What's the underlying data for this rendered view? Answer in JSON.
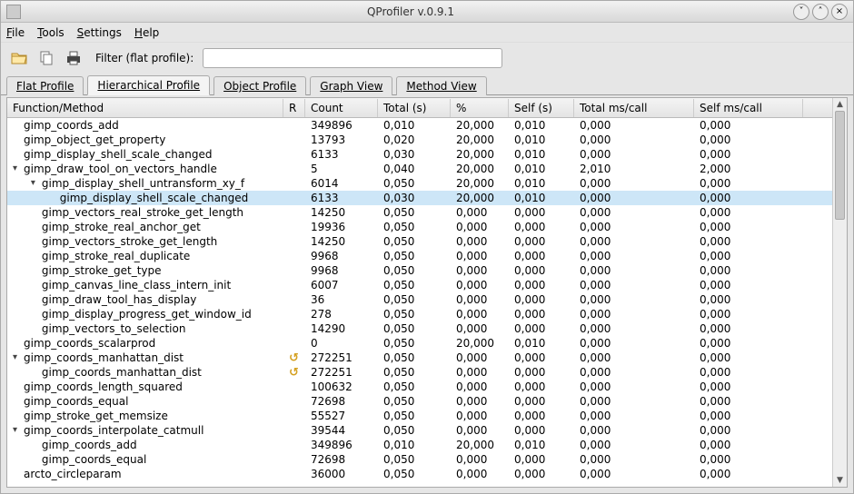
{
  "window": {
    "title": "QProfiler v.0.9.1"
  },
  "menu": {
    "file": "File",
    "tools": "Tools",
    "settings": "Settings",
    "help": "Help"
  },
  "toolbar": {
    "filter_label": "Filter (flat profile):",
    "filter_value": ""
  },
  "tabs": {
    "flat": "Flat Profile",
    "hierarchical": "Hierarchical Profile",
    "object": "Object Profile",
    "graph": "Graph View",
    "method": "Method View"
  },
  "columns": {
    "fn": "Function/Method",
    "r": "R",
    "count": "Count",
    "total": "Total (s)",
    "pct": "%",
    "self": "Self (s)",
    "total_ms": "Total ms/call",
    "self_ms": "Self ms/call"
  },
  "rows": [
    {
      "indent": 1,
      "exp": "",
      "r": "",
      "fn": "gimp_coords_add",
      "count": "349896",
      "total": "0,010",
      "pct": "20,000",
      "self": "0,010",
      "tms": "0,000",
      "sms": "0,000"
    },
    {
      "indent": 1,
      "exp": "",
      "r": "",
      "fn": "gimp_object_get_property",
      "count": "13793",
      "total": "0,020",
      "pct": "20,000",
      "self": "0,010",
      "tms": "0,000",
      "sms": "0,000"
    },
    {
      "indent": 1,
      "exp": "",
      "r": "",
      "fn": "gimp_display_shell_scale_changed",
      "count": "6133",
      "total": "0,030",
      "pct": "20,000",
      "self": "0,010",
      "tms": "0,000",
      "sms": "0,000"
    },
    {
      "indent": 1,
      "exp": "v",
      "r": "",
      "fn": "gimp_draw_tool_on_vectors_handle",
      "count": "5",
      "total": "0,040",
      "pct": "20,000",
      "self": "0,010",
      "tms": "2,010",
      "sms": "2,000"
    },
    {
      "indent": 2,
      "exp": "v",
      "r": "",
      "fn": "gimp_display_shell_untransform_xy_f",
      "count": "6014",
      "total": "0,050",
      "pct": "20,000",
      "self": "0,010",
      "tms": "0,000",
      "sms": "0,000"
    },
    {
      "indent": 3,
      "exp": "",
      "r": "",
      "fn": "gimp_display_shell_scale_changed",
      "count": "6133",
      "total": "0,030",
      "pct": "20,000",
      "self": "0,010",
      "tms": "0,000",
      "sms": "0,000",
      "selected": true
    },
    {
      "indent": 2,
      "exp": "",
      "r": "",
      "fn": "gimp_vectors_real_stroke_get_length",
      "count": "14250",
      "total": "0,050",
      "pct": "0,000",
      "self": "0,000",
      "tms": "0,000",
      "sms": "0,000"
    },
    {
      "indent": 2,
      "exp": "",
      "r": "",
      "fn": "gimp_stroke_real_anchor_get",
      "count": "19936",
      "total": "0,050",
      "pct": "0,000",
      "self": "0,000",
      "tms": "0,000",
      "sms": "0,000"
    },
    {
      "indent": 2,
      "exp": "",
      "r": "",
      "fn": "gimp_vectors_stroke_get_length",
      "count": "14250",
      "total": "0,050",
      "pct": "0,000",
      "self": "0,000",
      "tms": "0,000",
      "sms": "0,000"
    },
    {
      "indent": 2,
      "exp": "",
      "r": "",
      "fn": "gimp_stroke_real_duplicate",
      "count": "9968",
      "total": "0,050",
      "pct": "0,000",
      "self": "0,000",
      "tms": "0,000",
      "sms": "0,000"
    },
    {
      "indent": 2,
      "exp": "",
      "r": "",
      "fn": "gimp_stroke_get_type",
      "count": "9968",
      "total": "0,050",
      "pct": "0,000",
      "self": "0,000",
      "tms": "0,000",
      "sms": "0,000"
    },
    {
      "indent": 2,
      "exp": "",
      "r": "",
      "fn": "gimp_canvas_line_class_intern_init",
      "count": "6007",
      "total": "0,050",
      "pct": "0,000",
      "self": "0,000",
      "tms": "0,000",
      "sms": "0,000"
    },
    {
      "indent": 2,
      "exp": "",
      "r": "",
      "fn": "gimp_draw_tool_has_display",
      "count": "36",
      "total": "0,050",
      "pct": "0,000",
      "self": "0,000",
      "tms": "0,000",
      "sms": "0,000"
    },
    {
      "indent": 2,
      "exp": "",
      "r": "",
      "fn": "gimp_display_progress_get_window_id",
      "count": "278",
      "total": "0,050",
      "pct": "0,000",
      "self": "0,000",
      "tms": "0,000",
      "sms": "0,000"
    },
    {
      "indent": 2,
      "exp": "",
      "r": "",
      "fn": "gimp_vectors_to_selection",
      "count": "14290",
      "total": "0,050",
      "pct": "0,000",
      "self": "0,000",
      "tms": "0,000",
      "sms": "0,000"
    },
    {
      "indent": 1,
      "exp": "",
      "r": "",
      "fn": "gimp_coords_scalarprod",
      "count": "0",
      "total": "0,050",
      "pct": "20,000",
      "self": "0,010",
      "tms": "0,000",
      "sms": "0,000"
    },
    {
      "indent": 1,
      "exp": "v",
      "r": "rec",
      "fn": "gimp_coords_manhattan_dist",
      "count": "272251",
      "total": "0,050",
      "pct": "0,000",
      "self": "0,000",
      "tms": "0,000",
      "sms": "0,000"
    },
    {
      "indent": 2,
      "exp": "",
      "r": "rec",
      "fn": "gimp_coords_manhattan_dist",
      "count": "272251",
      "total": "0,050",
      "pct": "0,000",
      "self": "0,000",
      "tms": "0,000",
      "sms": "0,000"
    },
    {
      "indent": 1,
      "exp": "",
      "r": "",
      "fn": "gimp_coords_length_squared",
      "count": "100632",
      "total": "0,050",
      "pct": "0,000",
      "self": "0,000",
      "tms": "0,000",
      "sms": "0,000"
    },
    {
      "indent": 1,
      "exp": "",
      "r": "",
      "fn": "gimp_coords_equal",
      "count": "72698",
      "total": "0,050",
      "pct": "0,000",
      "self": "0,000",
      "tms": "0,000",
      "sms": "0,000"
    },
    {
      "indent": 1,
      "exp": "",
      "r": "",
      "fn": "gimp_stroke_get_memsize",
      "count": "55527",
      "total": "0,050",
      "pct": "0,000",
      "self": "0,000",
      "tms": "0,000",
      "sms": "0,000"
    },
    {
      "indent": 1,
      "exp": "v",
      "r": "",
      "fn": "gimp_coords_interpolate_catmull",
      "count": "39544",
      "total": "0,050",
      "pct": "0,000",
      "self": "0,000",
      "tms": "0,000",
      "sms": "0,000"
    },
    {
      "indent": 2,
      "exp": "",
      "r": "",
      "fn": "gimp_coords_add",
      "count": "349896",
      "total": "0,010",
      "pct": "20,000",
      "self": "0,010",
      "tms": "0,000",
      "sms": "0,000"
    },
    {
      "indent": 2,
      "exp": "",
      "r": "",
      "fn": "gimp_coords_equal",
      "count": "72698",
      "total": "0,050",
      "pct": "0,000",
      "self": "0,000",
      "tms": "0,000",
      "sms": "0,000"
    },
    {
      "indent": 1,
      "exp": "",
      "r": "",
      "fn": "arcto_circleparam",
      "count": "36000",
      "total": "0,050",
      "pct": "0,000",
      "self": "0,000",
      "tms": "0,000",
      "sms": "0,000"
    }
  ]
}
